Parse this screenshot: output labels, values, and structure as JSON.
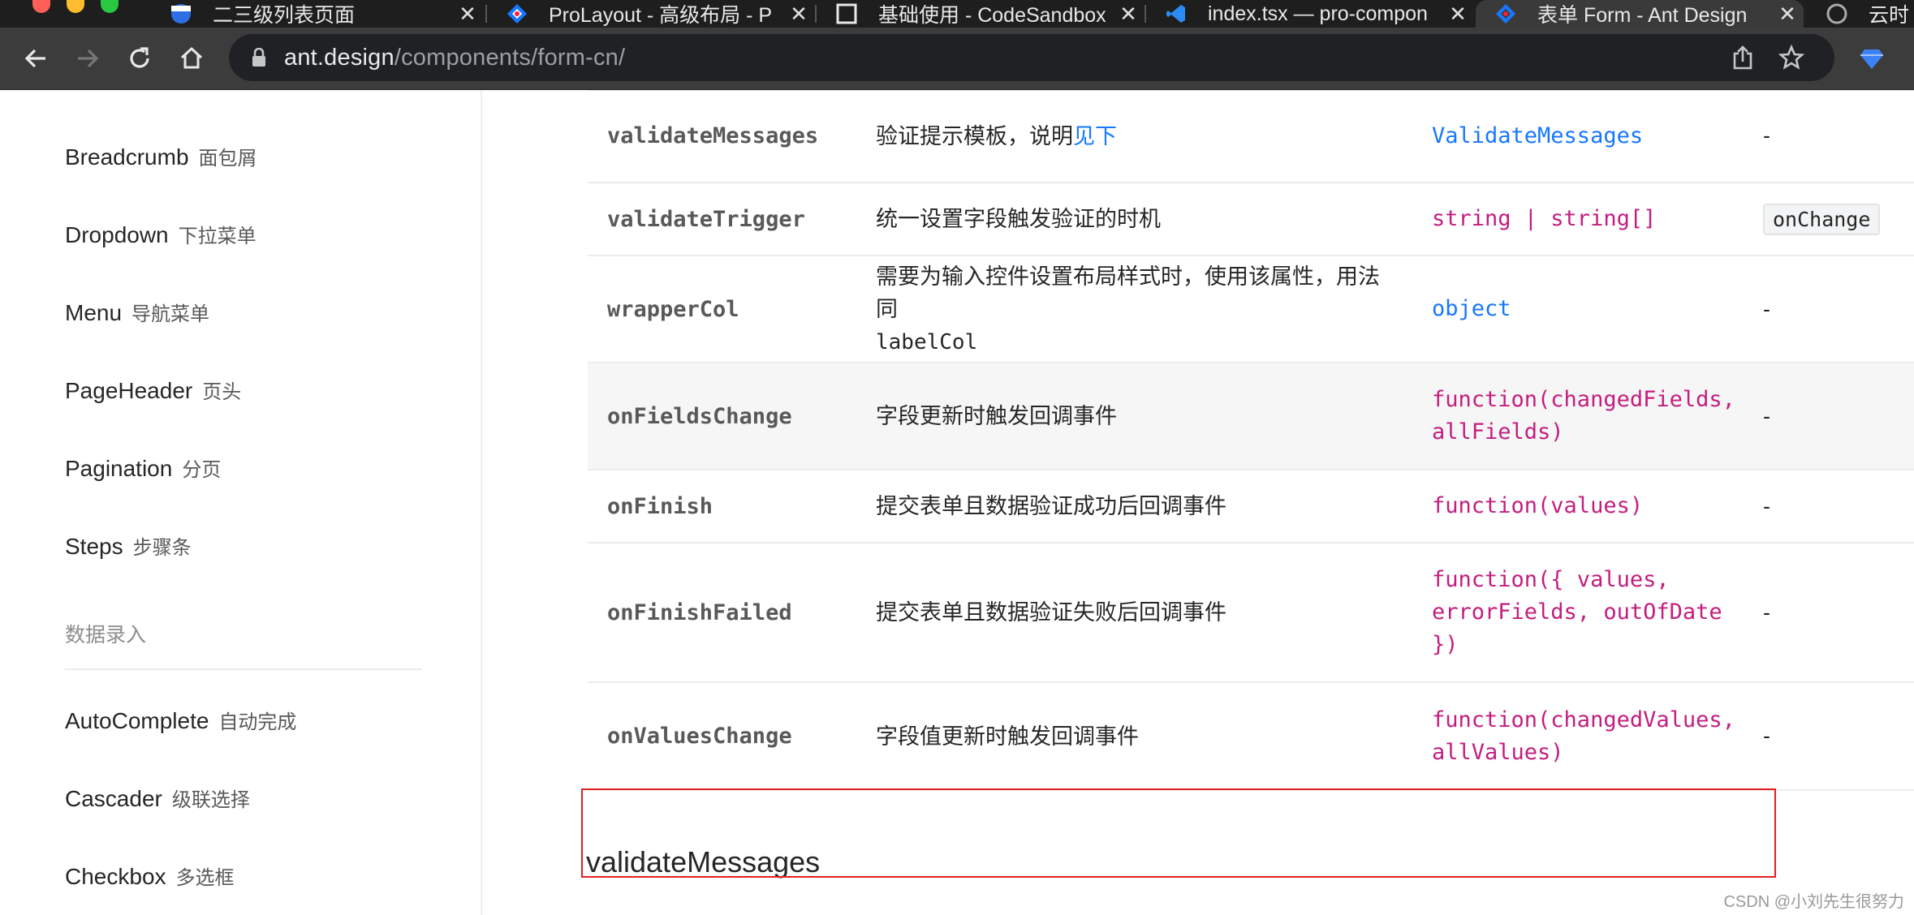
{
  "browser": {
    "traffic_colors": {
      "close": "#ff5f57",
      "minimize": "#febc2e",
      "maximize": "#28c840"
    },
    "tabs": [
      {
        "title": "二三级列表页面",
        "icon": "globe-icon"
      },
      {
        "title": "ProLayout - 高级布局 - P",
        "icon": "ant-logo-icon"
      },
      {
        "title": "基础使用 - CodeSandbox",
        "icon": "codesandbox-icon"
      },
      {
        "title": "index.tsx — pro-compon",
        "icon": "vscode-icon"
      },
      {
        "title": "表单 Form - Ant Design",
        "icon": "ant-logo-icon"
      },
      {
        "title": "云时",
        "icon": "globe-icon"
      }
    ],
    "close_glyph": "✕",
    "url_domain": "ant.design",
    "url_path": "/components/form-cn/"
  },
  "sidebar": {
    "items_top": [
      {
        "en": "Breadcrumb",
        "cn": "面包屑"
      },
      {
        "en": "Dropdown",
        "cn": "下拉菜单"
      },
      {
        "en": "Menu",
        "cn": "导航菜单"
      },
      {
        "en": "PageHeader",
        "cn": "页头"
      },
      {
        "en": "Pagination",
        "cn": "分页"
      },
      {
        "en": "Steps",
        "cn": "步骤条"
      }
    ],
    "group_label": "数据录入",
    "items_bottom": [
      {
        "en": "AutoComplete",
        "cn": "自动完成"
      },
      {
        "en": "Cascader",
        "cn": "级联选择"
      },
      {
        "en": "Checkbox",
        "cn": "多选框"
      }
    ]
  },
  "table": {
    "rows": [
      {
        "name": "validateMessages",
        "desc": "验证提示模板，说明",
        "desc_link": "见下",
        "type_lines": [
          "ValidateMessages"
        ],
        "type_color": "blue",
        "default": "-"
      },
      {
        "name": "validateTrigger",
        "desc": "统一设置字段触发验证的时机",
        "type_lines": [
          "string | string[]"
        ],
        "type_color": "magenta",
        "default_tag": "onChange"
      },
      {
        "name": "wrapperCol",
        "desc": "需要为输入控件设置布局样式时，使用该属性，用法同",
        "desc_code": "labelCol",
        "type_lines": [
          "object"
        ],
        "type_color": "blue",
        "default": "-"
      },
      {
        "name": "onFieldsChange",
        "desc": "字段更新时触发回调事件",
        "type_lines": [
          "function(changedFields,",
          "allFields)"
        ],
        "type_color": "magenta",
        "default": "-",
        "highlight": true
      },
      {
        "name": "onFinish",
        "desc": "提交表单且数据验证成功后回调事件",
        "type_lines": [
          "function(values)"
        ],
        "type_color": "magenta",
        "default": "-"
      },
      {
        "name": "onFinishFailed",
        "desc": "提交表单且数据验证失败后回调事件",
        "type_lines": [
          "function({ values,",
          "errorFields, outOfDate",
          "})"
        ],
        "type_color": "magenta",
        "default": "-"
      },
      {
        "name": "onValuesChange",
        "desc": "字段值更新时触发回调事件",
        "type_lines": [
          "function(changedValues,",
          "allValues)"
        ],
        "type_color": "magenta",
        "default": "-"
      }
    ]
  },
  "section_heading": "validateMessages",
  "watermark": "CSDN @小刘先生很努力"
}
